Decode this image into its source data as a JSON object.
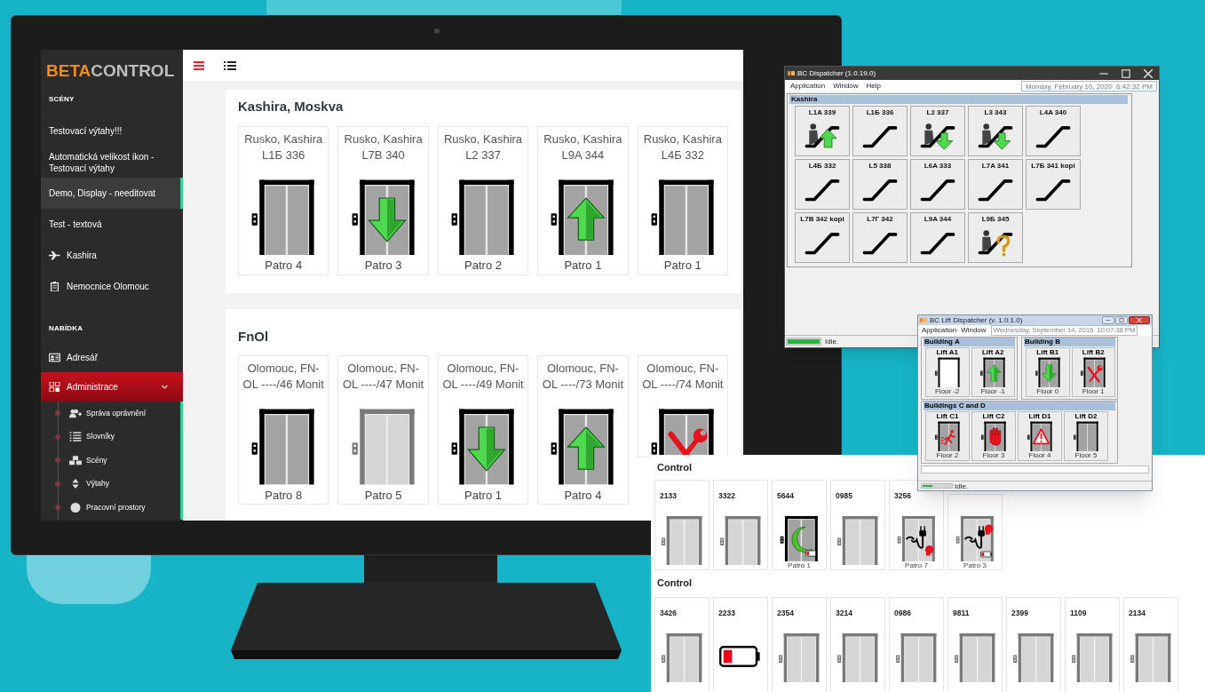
{
  "web_app": {
    "logo": {
      "part_1": "BETA",
      "part_2": "CONTROL"
    },
    "sidebar": {
      "sections": [
        {
          "heading": "SCÉNY",
          "items": [
            {
              "label": "Testovací výtahy!!!",
              "selected": false
            },
            {
              "label": "Automatická velikost ikon - Testovací výtahy",
              "selected": false
            },
            {
              "label": "Demo, Display - needitovat",
              "selected": true
            },
            {
              "label": "Test - textová",
              "selected": false
            },
            {
              "label": "Kashira",
              "selected": false
            },
            {
              "label": "Nemocnice Olomouc",
              "selected": false
            }
          ]
        },
        {
          "heading": "NABÍDKA",
          "items": [
            {
              "label": "Adresář",
              "selected": false
            },
            {
              "label": "Administrace",
              "selected": true,
              "expanded": true,
              "children": [
                {
                  "label": "Správa oprávnění",
                  "selected": false
                },
                {
                  "label": "Slovníky",
                  "selected": false
                },
                {
                  "label": "Scény",
                  "selected": false
                },
                {
                  "label": "Výtahy",
                  "selected": false
                },
                {
                  "label": "Pracovní prostory",
                  "selected": false
                }
              ]
            }
          ]
        }
      ]
    },
    "scenes": [
      {
        "title": "Kashira, Moskva",
        "lifts": [
          {
            "name_lines": [
              "Rusko, Kashira",
              "L1Б 336"
            ],
            "kind": "idle",
            "floor": "Patro 4"
          },
          {
            "name_lines": [
              "Rusko, Kashira",
              "L7B 340"
            ],
            "kind": "down",
            "floor": "Patro 3"
          },
          {
            "name_lines": [
              "Rusko, Kashira",
              "L2 337"
            ],
            "kind": "idle",
            "floor": "Patro 2"
          },
          {
            "name_lines": [
              "Rusko, Kashira",
              "L9A 344"
            ],
            "kind": "up",
            "floor": "Patro 1"
          },
          {
            "name_lines": [
              "Rusko, Kashira",
              "L4Б 332"
            ],
            "kind": "idle",
            "floor": "Patro 1"
          }
        ]
      },
      {
        "title": "FnOl",
        "lifts": [
          {
            "name_lines": [
              "Olomouc, FN-",
              "OL ----/46 Monit"
            ],
            "kind": "idle",
            "floor": "Patro 8"
          },
          {
            "name_lines": [
              "Olomouc, FN-",
              "OL ----/47 Monit"
            ],
            "kind": "offline",
            "floor": "Patro 5"
          },
          {
            "name_lines": [
              "Olomouc, FN-",
              "OL ----/49 Monit"
            ],
            "kind": "down",
            "floor": "Patro 1"
          },
          {
            "name_lines": [
              "Olomouc, FN-",
              "OL ----/73 Monit"
            ],
            "kind": "up",
            "floor": "Patro 4"
          },
          {
            "name_lines": [
              "Olomouc, FN-",
              "OL ----/74 Monit"
            ],
            "kind": "fault"
          }
        ]
      }
    ]
  },
  "dispatcher_window": {
    "title": "BC Dispatcher (1.0.19.0)",
    "menu": [
      "Application",
      "Window",
      "Help"
    ],
    "datetime": "Monday, February 10, 2020  6:42:32 PM",
    "group": "Kashira",
    "escalators": [
      {
        "label": "L1A 339",
        "kind": "up"
      },
      {
        "label": "L1Б 336",
        "kind": "idle"
      },
      {
        "label": "L2 337",
        "kind": "down"
      },
      {
        "label": "L3 343",
        "kind": "down"
      },
      {
        "label": "L4A 340",
        "kind": "idle"
      },
      {
        "label": "L4Б 332",
        "kind": "idle"
      },
      {
        "label": "L5 338",
        "kind": "idle"
      },
      {
        "label": "L6A 333",
        "kind": "idle"
      },
      {
        "label": "L7A 341",
        "kind": "idle"
      },
      {
        "label": "L7Б 341 kopi",
        "kind": "idle"
      },
      {
        "label": "L7B 342 kopi",
        "kind": "idle"
      },
      {
        "label": "L7Г 342",
        "kind": "idle"
      },
      {
        "label": "L9A 344",
        "kind": "idle"
      },
      {
        "label": "L9Б 345",
        "kind": "unknown"
      }
    ],
    "status": {
      "level": 1,
      "text": "Idle."
    }
  },
  "lift_dispatcher_window": {
    "title": "BC Lift Dispatcher (v. 1.0.1.0)",
    "menu": [
      "Application",
      "Window"
    ],
    "datetime": "Wednesday, September 14, 2016  10:07:38 PM",
    "groups": [
      {
        "title": "Building A",
        "lifts": [
          {
            "name": "Lift A1",
            "kind": "open",
            "floor": "Floor -2"
          },
          {
            "name": "Lift A2",
            "kind": "up",
            "floor": "Floor -1"
          }
        ]
      },
      {
        "title": "Building B",
        "lifts": [
          {
            "name": "Lift B1",
            "kind": "down",
            "floor": "Floor 0"
          },
          {
            "name": "Lift B2",
            "kind": "fault",
            "floor": "Floor 1"
          }
        ]
      },
      {
        "title": "Buildings C and D",
        "lifts": [
          {
            "name": "Lift C1",
            "kind": "fire",
            "floor": "Floor 2"
          },
          {
            "name": "Lift C2",
            "kind": "stop",
            "floor": "Floor 3"
          },
          {
            "name": "Lift D1",
            "kind": "alarm",
            "floor": "Floor 4"
          },
          {
            "name": "Lift D2",
            "kind": "idle",
            "floor": "Floor 5"
          }
        ]
      }
    ],
    "status": {
      "level": 0.35,
      "text": "Idle."
    }
  },
  "control_panel": {
    "groups": [
      {
        "title": "Control",
        "tiles": [
          {
            "id": "2133",
            "kind": "offline"
          },
          {
            "id": "3322",
            "kind": "offline"
          },
          {
            "id": "5644",
            "kind": "sleep",
            "floor": "Patro 1"
          },
          {
            "id": "0985",
            "kind": "offline"
          },
          {
            "id": "3256",
            "kind": "unplugged",
            "floor": "Patro 7"
          },
          {
            "kind": "unplugged_battery",
            "floor": "Patro 3"
          }
        ]
      },
      {
        "title": "Control",
        "tiles": [
          {
            "id": "3426",
            "kind": "offline"
          },
          {
            "id": "2233",
            "kind": "battery"
          },
          {
            "id": "2354",
            "kind": "offline"
          },
          {
            "id": "3214",
            "kind": "offline"
          },
          {
            "id": "0986",
            "kind": "offline"
          },
          {
            "id": "9811",
            "kind": "offline"
          },
          {
            "id": "2399",
            "kind": "offline"
          },
          {
            "id": "1109",
            "kind": "offline"
          },
          {
            "id": "2134",
            "kind": "offline"
          }
        ]
      }
    ]
  }
}
